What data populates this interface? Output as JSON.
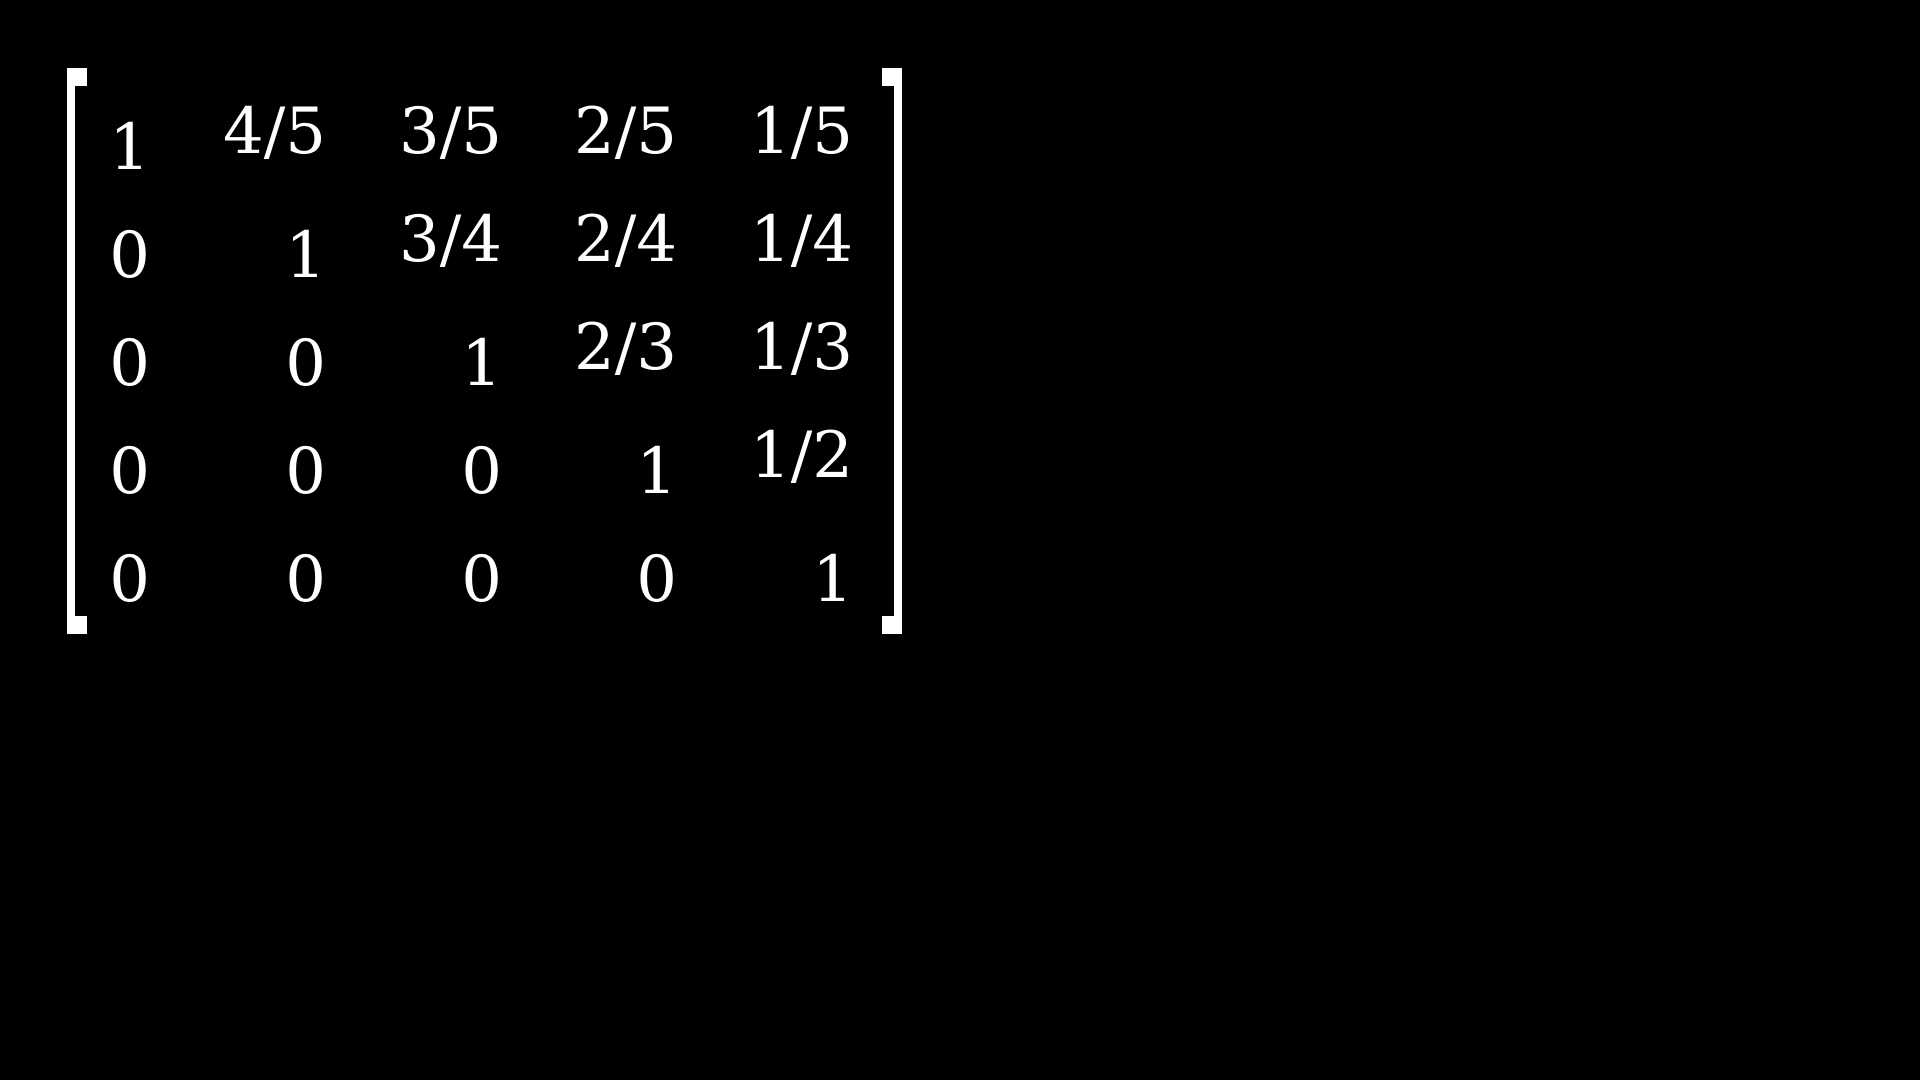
{
  "matrix": {
    "rows": [
      [
        "1",
        "4/5",
        "3/5",
        "2/5",
        "1/5"
      ],
      [
        "0",
        "1",
        "3/4",
        "2/4",
        "1/4"
      ],
      [
        "0",
        "0",
        "1",
        "2/3",
        "1/3"
      ],
      [
        "0",
        "0",
        "0",
        "1",
        "1/2"
      ],
      [
        "0",
        "0",
        "0",
        "0",
        "1"
      ]
    ]
  },
  "colors": {
    "background": "#000000",
    "foreground": "#ffffff"
  }
}
